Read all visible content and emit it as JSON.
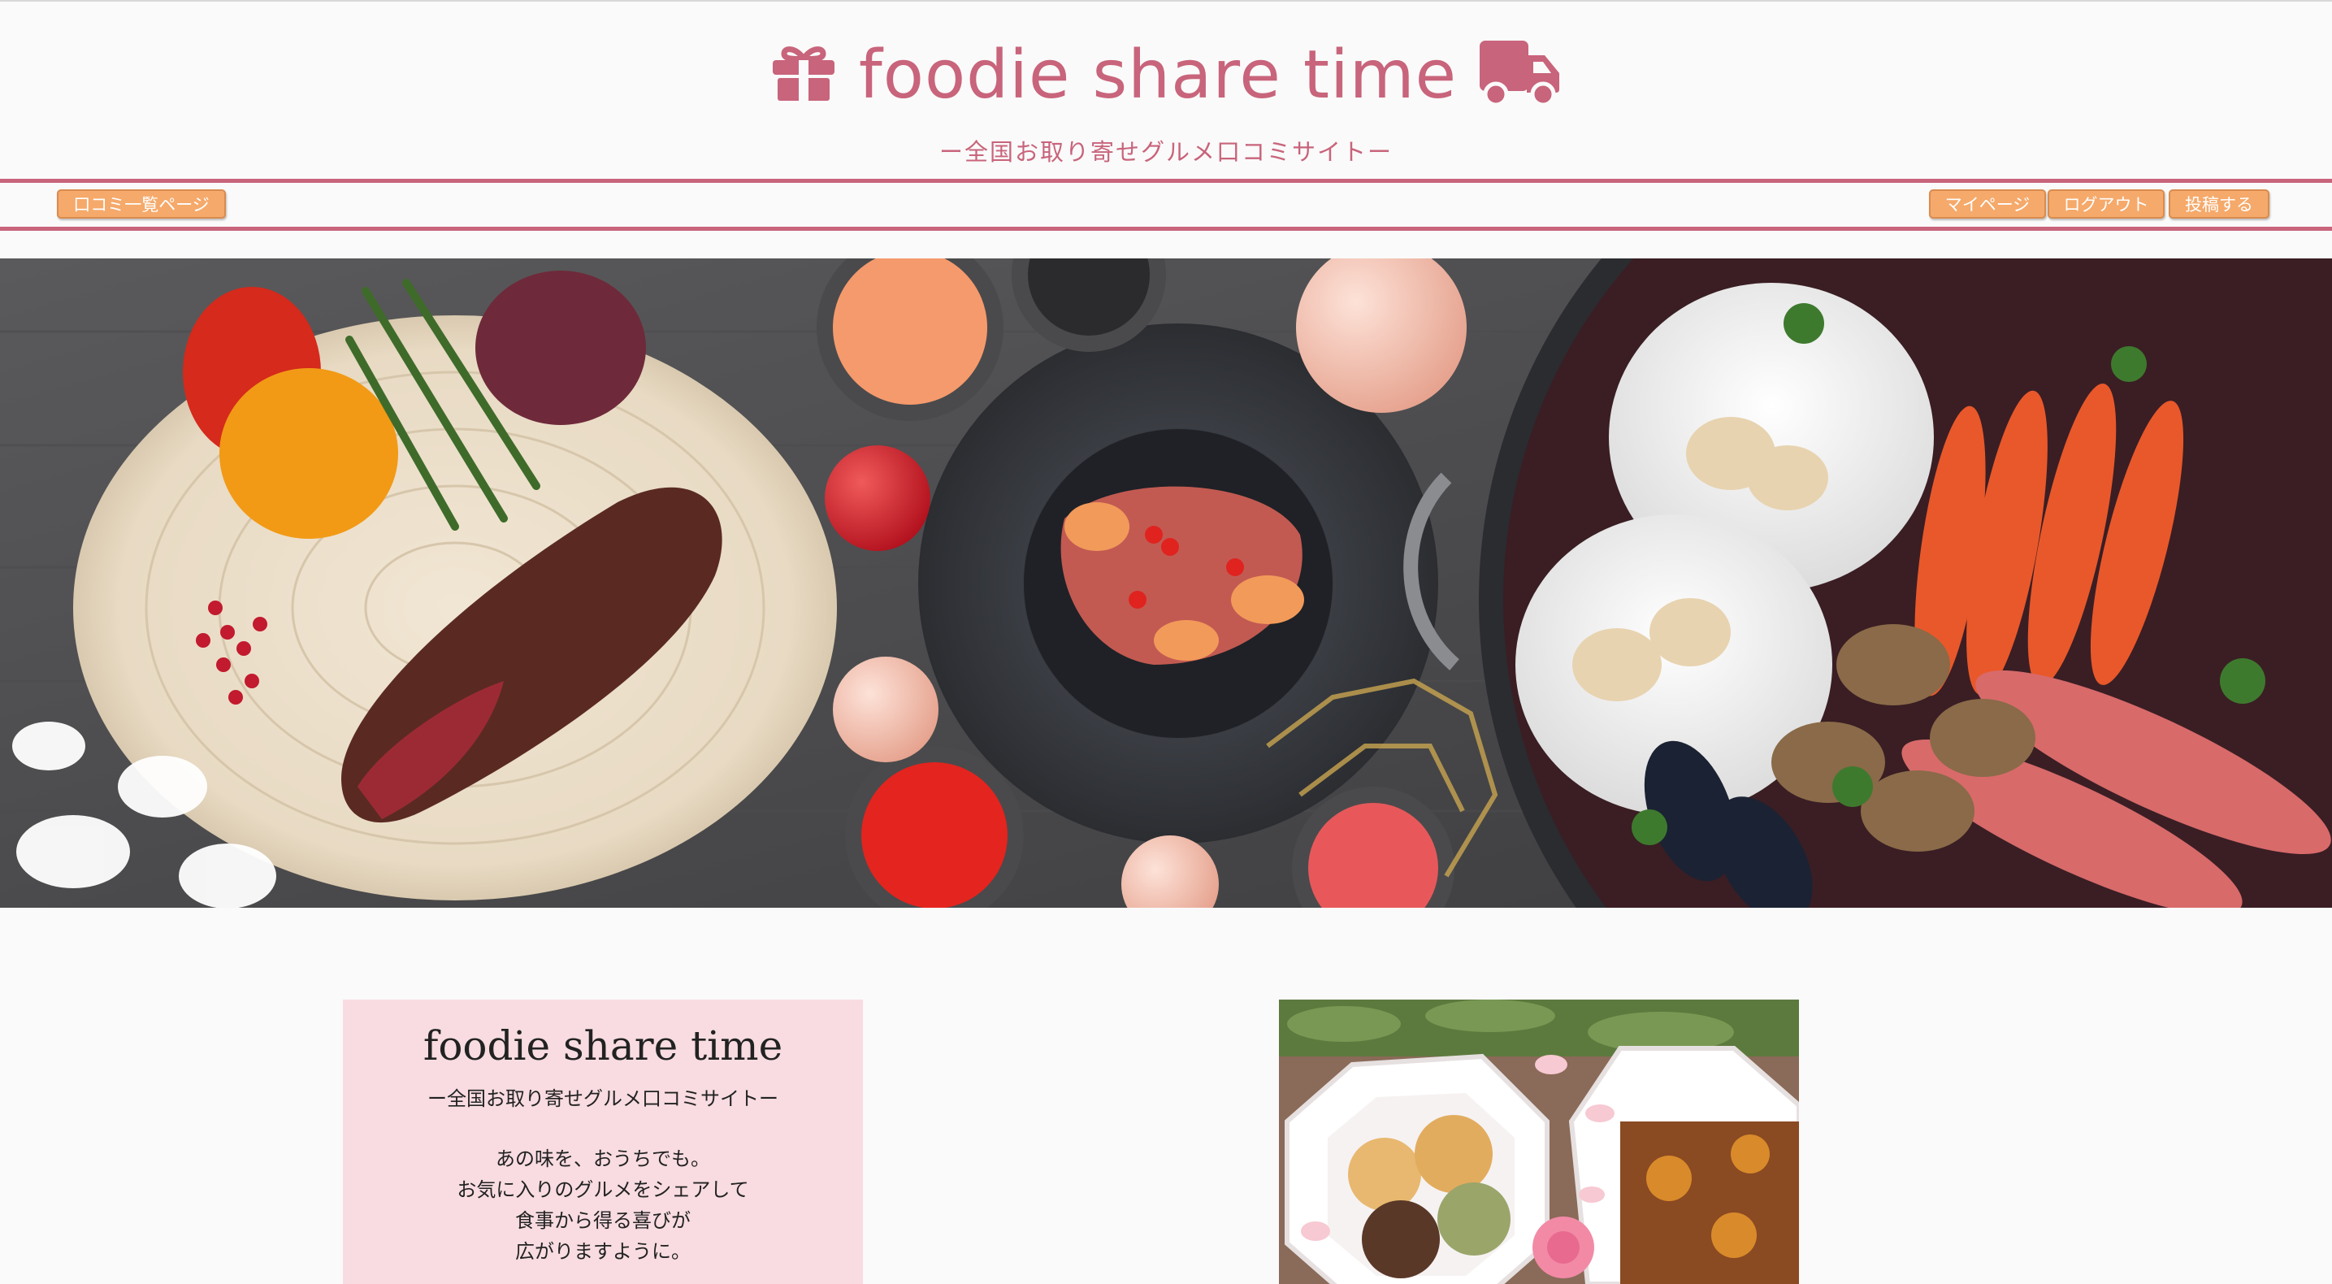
{
  "header": {
    "title": "foodie share time",
    "subtitle": "ー全国お取り寄せグルメ口コミサイトー",
    "left_icon": "gift-icon",
    "right_icon": "truck-icon"
  },
  "nav": {
    "review_list": "口コミ一覧ページ",
    "mypage": "マイページ",
    "logout": "ログアウト",
    "post": "投稿する"
  },
  "hero": {
    "image": "hero-food-photo"
  },
  "about": {
    "title": "foodie share time",
    "subtitle": "ー全国お取り寄せグルメ口コミサイトー",
    "lines": [
      "あの味を、おうちでも。",
      "お気に入りのグルメをシェアして",
      "食事から得る喜びが",
      "広がりますように。"
    ]
  },
  "side_image": {
    "image": "sweets-photo"
  },
  "colors": {
    "brand": "#c8647b",
    "button": "#f5a96a",
    "card": "#f8dce1",
    "background": "#fafafa"
  }
}
